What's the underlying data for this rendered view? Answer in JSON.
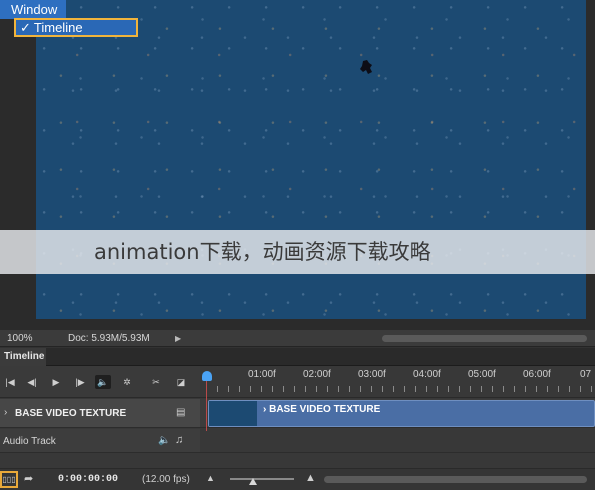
{
  "menu": {
    "title": "Window",
    "checked_item": {
      "check": "✓",
      "label": "Timeline"
    }
  },
  "watermark": "animation下载，动画资源下载攻略",
  "status_bar": {
    "zoom": "100%",
    "doc_info": "Doc: 5.93M/5.93M",
    "arrow": "▶"
  },
  "timeline": {
    "tab_label": "Timeline",
    "controls": {
      "first_frame": "|◀",
      "prev_frame": "◀|",
      "play": "▶",
      "next_frame": "|▶",
      "audio": "🔈",
      "settings": "✲",
      "split": "✂",
      "transition": "◪"
    },
    "ruler_labels": [
      "01:00f",
      "02:00f",
      "03:00f",
      "04:00f",
      "05:00f",
      "06:00f",
      "07"
    ],
    "video_track": {
      "chevron": "›",
      "label": "BASE VIDEO TEXTURE",
      "menu_icon": "▤",
      "clip_label": "›  BASE VIDEO TEXTURE"
    },
    "audio_track": {
      "label": "Audio Track",
      "speaker": "🔈",
      "note": "♫"
    },
    "footer": {
      "frames_button": "▯▯▯",
      "convert": "➦",
      "timecode": "0:00:00:00",
      "fps": "(12.00 fps)",
      "zoom_out": "▲",
      "zoom_in": "▲"
    }
  },
  "colors": {
    "accent_blue": "#2e6fc0",
    "highlight_border": "#f1b43c",
    "clip_blue": "#4a6ea5",
    "canvas_blue": "#1c4a72",
    "playhead": "#4aa3f5"
  }
}
